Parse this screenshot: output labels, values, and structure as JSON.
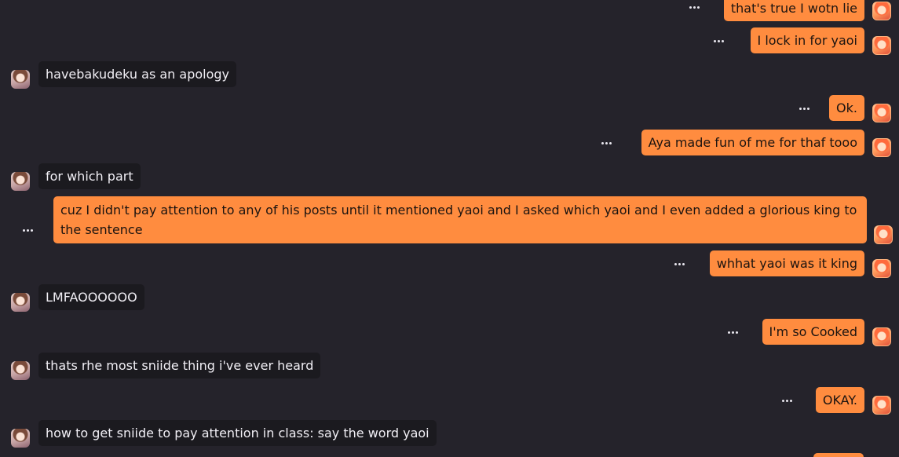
{
  "colors": {
    "background": "#25232b",
    "incoming_bubble": "#1b1a1f",
    "outgoing_bubble": "#ff8c3f"
  },
  "icons": {
    "more": "more-options-icon",
    "user_avatar": "user-avatar-icon",
    "self_avatar": "self-avatar-icon"
  },
  "messages": [
    {
      "direction": "out",
      "text": "that's true I wotn lie"
    },
    {
      "direction": "out",
      "text": "I lock in for yaoi"
    },
    {
      "direction": "in",
      "text": "havebakudeku as an apology"
    },
    {
      "direction": "out",
      "text": "Ok."
    },
    {
      "direction": "out",
      "text": "Aya made fun of me for thaf tooo"
    },
    {
      "direction": "in",
      "text": "for which part"
    },
    {
      "direction": "out",
      "text": "cuz I didn't pay attention to any of his posts until it mentioned yaoi and I asked which yaoi and I even added a glorious king to the sentence"
    },
    {
      "direction": "out",
      "text": "whhat yaoi was it king"
    },
    {
      "direction": "in",
      "text": "LMFAOOOOOO"
    },
    {
      "direction": "out",
      "text": "I'm so Cooked"
    },
    {
      "direction": "in",
      "text": "thats rhe most sniide thing i've ever heard"
    },
    {
      "direction": "out",
      "text": "OKAY."
    },
    {
      "direction": "in",
      "text": "how to get sniide to pay attention in class: say the word yaoi"
    }
  ]
}
